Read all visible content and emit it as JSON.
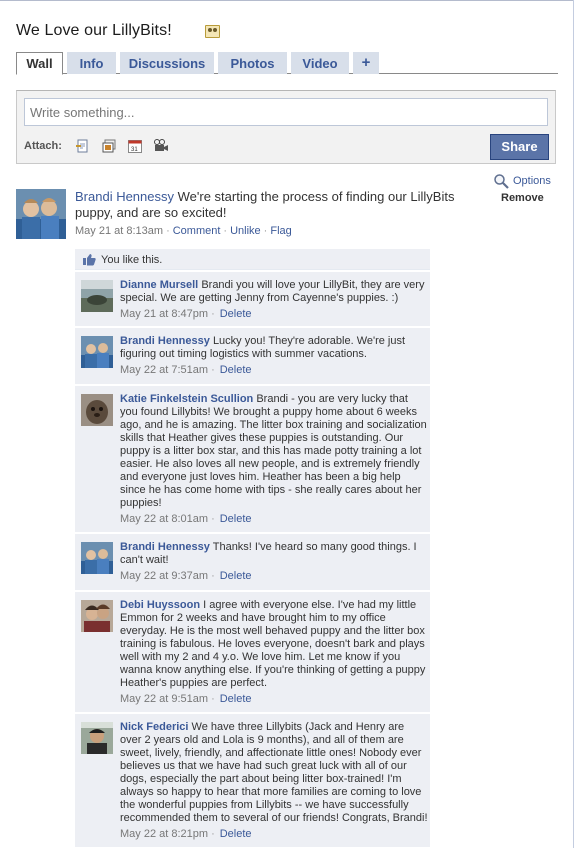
{
  "page": {
    "title": "We Love our LillyBits!"
  },
  "tabs": [
    {
      "label": "Wall",
      "active": true
    },
    {
      "label": "Info"
    },
    {
      "label": "Discussions"
    },
    {
      "label": "Photos"
    },
    {
      "label": "Video"
    },
    {
      "label": "+"
    }
  ],
  "composer": {
    "placeholder": "Write something...",
    "attach_label": "Attach:",
    "attach_icons": [
      "link-icon",
      "photo-icon",
      "event-icon",
      "video-icon"
    ],
    "share_label": "Share"
  },
  "post": {
    "options_label": "Options",
    "remove_label": "Remove",
    "author": "Brandi Hennessy",
    "text": "We're starting the process of finding our LillyBits puppy, and are so excited!",
    "time": "May 21 at 8:13am",
    "actions": {
      "comment": "Comment",
      "unlike": "Unlike",
      "flag": "Flag"
    },
    "like_text": "You like this."
  },
  "comments": [
    {
      "author": "Dianne Mursell",
      "text": "Brandi you will love your LillyBit, they are very special. We are getting Jenny from Cayenne's puppies. :)",
      "time": "May 21 at 8:47pm",
      "delete": "Delete"
    },
    {
      "author": "Brandi Hennessy",
      "text": "Lucky you! They're adorable. We're just figuring out timing logistics with summer vacations.",
      "time": "May 22 at 7:51am",
      "delete": "Delete"
    },
    {
      "author": "Katie Finkelstein Scullion",
      "text": "Brandi - you are very lucky that you found Lillybits! We brought a puppy home about 6 weeks ago, and he is amazing. The litter box training and socialization skills that Heather gives these puppies is outstanding. Our puppy is a litter box star, and this has made potty training a lot easier. He also loves all new people, and is extremely friendly and everyone just loves him. Heather has been a big help since he has come home with tips - she really cares about her puppies!",
      "time": "May 22 at 8:01am",
      "delete": "Delete"
    },
    {
      "author": "Brandi Hennessy",
      "text": "Thanks! I've heard so many good things. I can't wait!",
      "time": "May 22 at 9:37am",
      "delete": "Delete"
    },
    {
      "author": "Debi Huyssoon",
      "text": "I agree with everyone else. I've had my little Emmon for 2 weeks and have brought him to my office everyday. He is the most well behaved puppy and the litter box training is fabulous. He loves everyone, doesn't bark and plays well with my 2 and 4 y.o. We love him. Let me know if you wanna know anything else. If you're thinking of getting a puppy Heather's puppies are perfect.",
      "time": "May 22 at 9:51am",
      "delete": "Delete"
    },
    {
      "author": "Nick Federici",
      "text": "We have three Lillybits (Jack and Henry are over 2 years old and Lola is 9 months), and all of them are sweet, lively, friendly, and affectionate little ones! Nobody ever believes us that we have had such great luck with all of our dogs, especially the part about being litter box-trained! I'm always so happy to hear that more families are coming to love the wonderful puppies from Lillybits -- we have successfully recommended them to several of our friends! Congrats, Brandi!",
      "time": "May 22 at 8:21pm",
      "delete": "Delete"
    }
  ]
}
